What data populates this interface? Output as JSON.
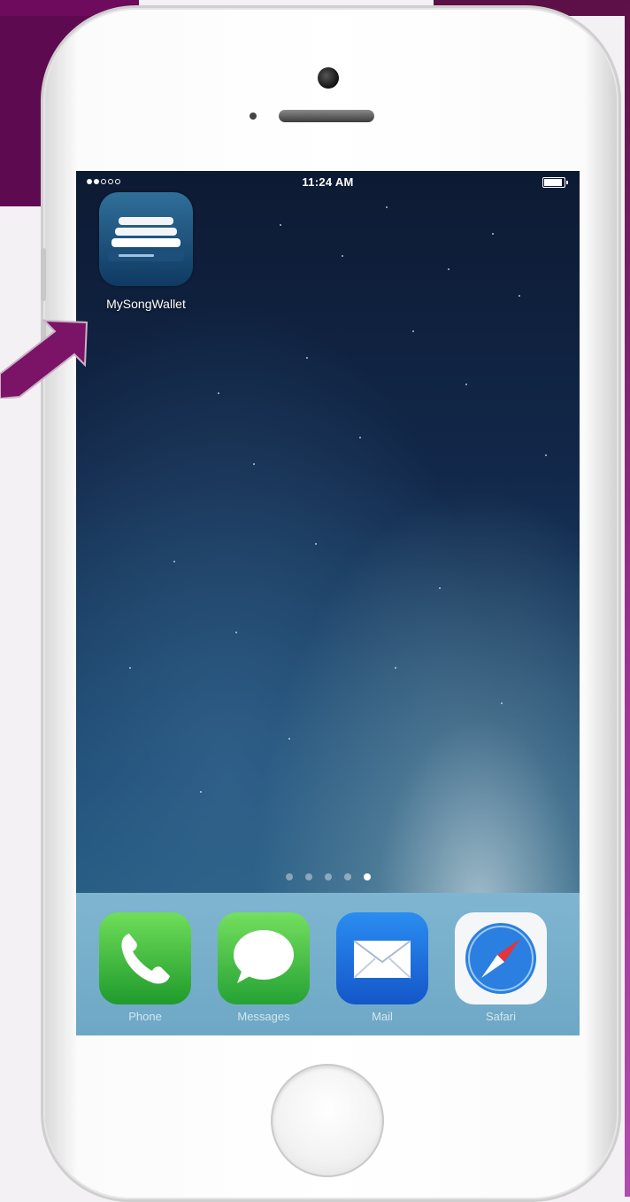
{
  "status_bar": {
    "time": "11:24 AM"
  },
  "home_screen": {
    "app": {
      "label": "MySongWallet",
      "icon": "mysongwallet-icon"
    },
    "page_indicator": {
      "pages": 5,
      "active_page": 5
    }
  },
  "dock": {
    "items": [
      {
        "label": "Phone",
        "icon": "phone-icon"
      },
      {
        "label": "Messages",
        "icon": "messages-icon"
      },
      {
        "label": "Mail",
        "icon": "mail-icon"
      },
      {
        "label": "Safari",
        "icon": "safari-icon"
      }
    ]
  },
  "annotation": {
    "arrow_color": "#7b1466"
  },
  "colors": {
    "accent": "#6e0b5d"
  }
}
